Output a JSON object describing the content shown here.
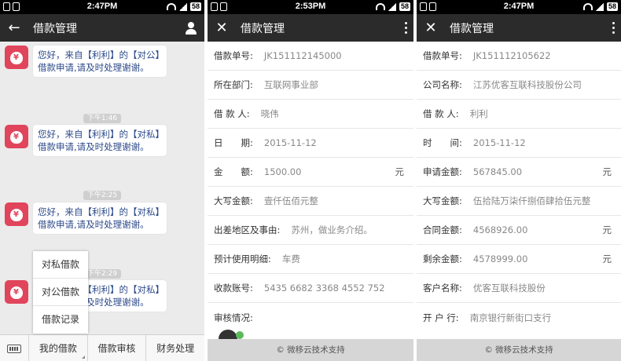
{
  "screen1": {
    "status": {
      "time": "2:47PM",
      "battery": "58"
    },
    "nav": {
      "title": "借款管理"
    },
    "messages": [
      {
        "text": "您好，来自【利利】的【对公】借款申请,请及时处理谢谢。"
      },
      {
        "timestamp": "下午1:46",
        "text": "您好，来自【利利】的【对私】借款申请,请及时处理谢谢。"
      },
      {
        "timestamp": "下午2:25",
        "text": "您好，来自【利利】的【对私】借款申请,请及时处理谢谢。"
      },
      {
        "timestamp": "下午2:29",
        "text": "您好，来自【利利】的【对私】借款申请,请及时处理谢谢。"
      }
    ],
    "popup_menu": [
      "对私借款",
      "对公借款",
      "借款记录"
    ],
    "tabs": [
      "我的借款",
      "借款审核",
      "财务处理"
    ]
  },
  "screen2": {
    "status": {
      "time": "2:53PM",
      "battery": "58"
    },
    "nav": {
      "title": "借款管理"
    },
    "fields": [
      {
        "label": "借款单号:",
        "value": "JK151112145000"
      },
      {
        "label": "所在部门:",
        "value": "互联网事业部"
      },
      {
        "label": "借 款 人:",
        "value": "晓伟"
      },
      {
        "label": "日　　期:",
        "value": "2015-11-12"
      },
      {
        "label": "金　　额:",
        "value": "1500.00",
        "unit": "元"
      },
      {
        "label": "大写金额:",
        "value": "壹仟伍佰元整"
      },
      {
        "label": "出差地区及事由:",
        "value": "苏州，做业务介绍。"
      },
      {
        "label": "预计使用明细:",
        "value": "车费"
      },
      {
        "label": "收款账号:",
        "value": "5435 6682 3368 4552 752"
      },
      {
        "label": "审核情况:",
        "value": ""
      }
    ],
    "footer": "© 微移云技术支持"
  },
  "screen3": {
    "status": {
      "time": "2:47PM",
      "battery": "58"
    },
    "nav": {
      "title": "借款管理"
    },
    "fields": [
      {
        "label": "借款单号:",
        "value": "JK151112105622"
      },
      {
        "label": "公司名称:",
        "value": "江苏优客互联科技股份公司"
      },
      {
        "label": "借 款 人:",
        "value": "利利"
      },
      {
        "label": "时　　间:",
        "value": "2015-11-12"
      },
      {
        "label": "申请金额:",
        "value": "567845.00",
        "unit": "元"
      },
      {
        "label": "大写金额:",
        "value": "伍拾陆万柒仟捌佰肆拾伍元整"
      },
      {
        "label": "合同金额:",
        "value": "4568926.00",
        "unit": "元"
      },
      {
        "label": "剩余金额:",
        "value": "4578999.00",
        "unit": "元"
      },
      {
        "label": "客户名称:",
        "value": "优客互联科技股份"
      },
      {
        "label": "开 户 行:",
        "value": "南京银行新街口支行"
      }
    ],
    "footer": "© 微移云技术支持"
  }
}
